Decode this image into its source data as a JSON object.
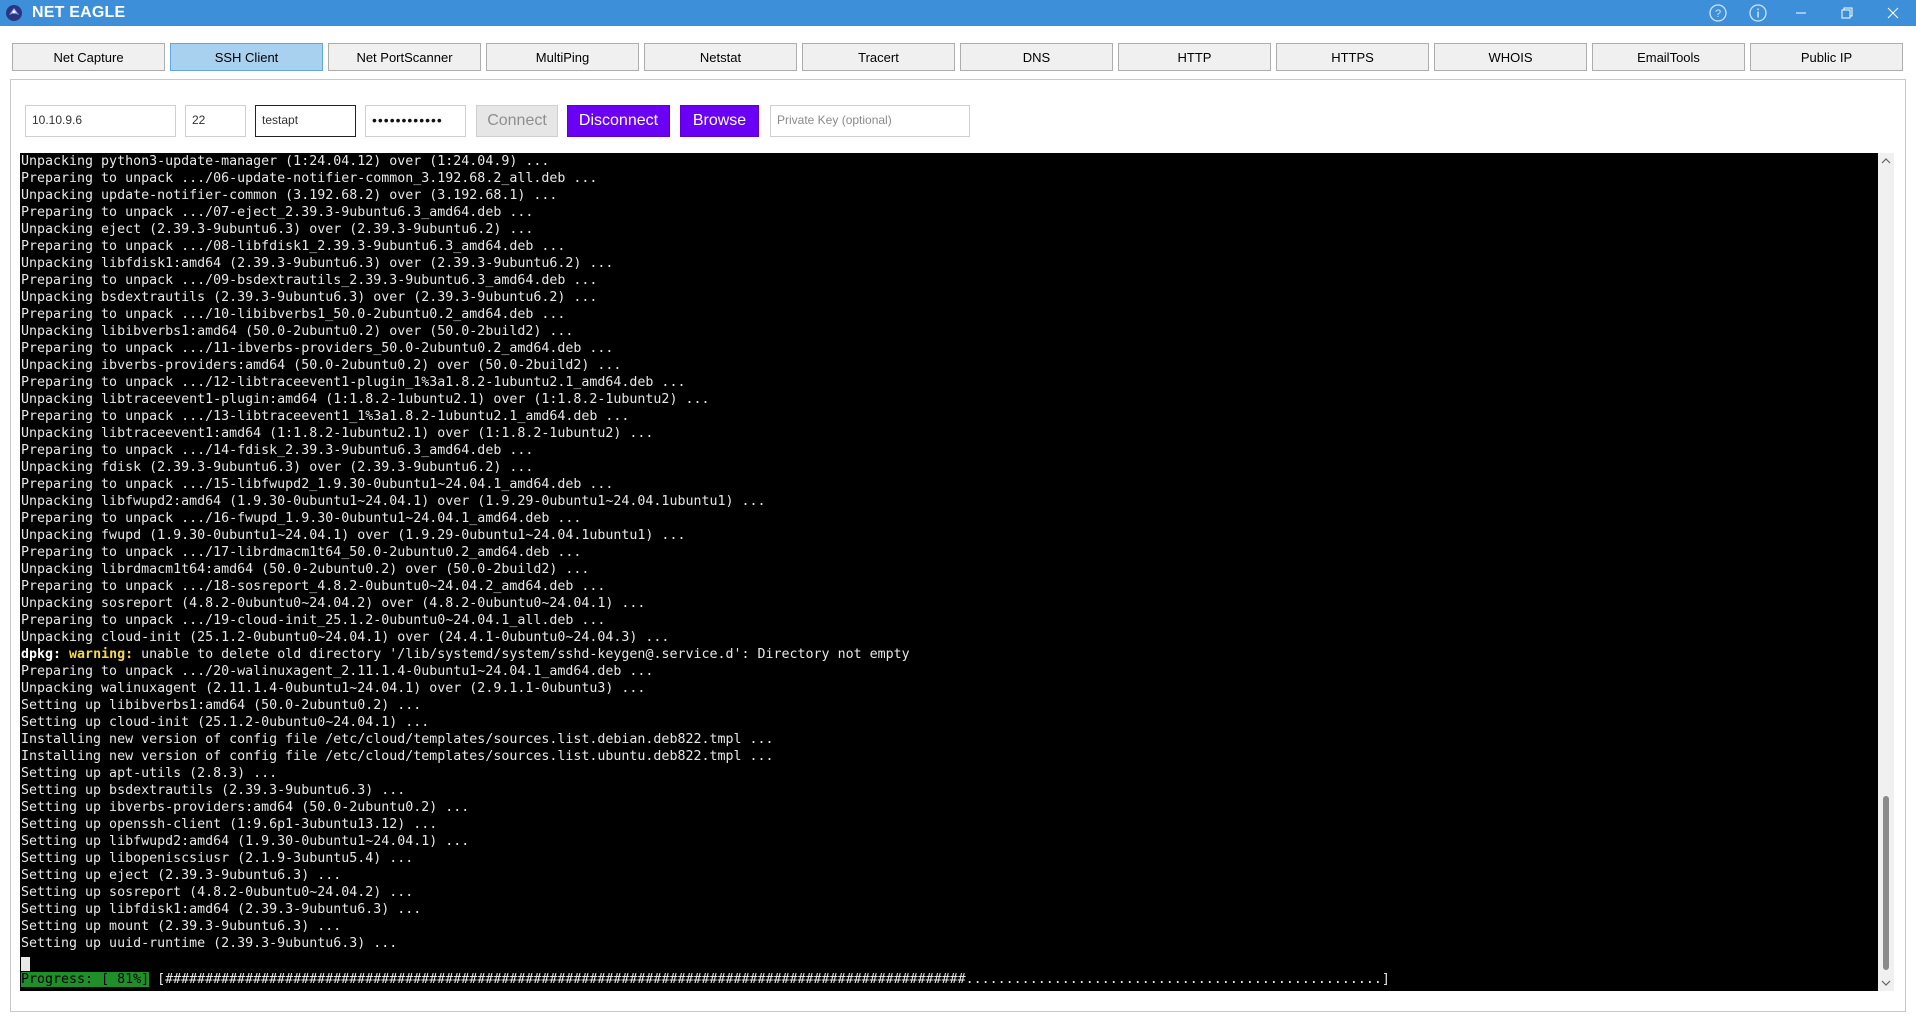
{
  "window": {
    "title": "NET EAGLE",
    "controls": [
      "help-icon",
      "info-icon",
      "minimize-icon",
      "restore-icon",
      "close-icon"
    ]
  },
  "tabs": [
    {
      "label": "Net Capture",
      "active": false
    },
    {
      "label": "SSH Client",
      "active": true
    },
    {
      "label": "Net PortScanner",
      "active": false
    },
    {
      "label": "MultiPing",
      "active": false
    },
    {
      "label": "Netstat",
      "active": false
    },
    {
      "label": "Tracert",
      "active": false
    },
    {
      "label": "DNS",
      "active": false
    },
    {
      "label": "HTTP",
      "active": false
    },
    {
      "label": "HTTPS",
      "active": false
    },
    {
      "label": "WHOIS",
      "active": false
    },
    {
      "label": "EmailTools",
      "active": false
    },
    {
      "label": "Public IP",
      "active": false
    }
  ],
  "ssh": {
    "host": "10.10.9.6",
    "port": "22",
    "username": "testapt",
    "password_mask": "••••••••••••",
    "connect_label": "Connect",
    "disconnect_label": "Disconnect",
    "browse_label": "Browse",
    "private_key_placeholder": "Private Key (optional)"
  },
  "terminal": {
    "lines": [
      "Unpacking python3-update-manager (1:24.04.12) over (1:24.04.9) ...",
      "Preparing to unpack .../06-update-notifier-common_3.192.68.2_all.deb ...",
      "Unpacking update-notifier-common (3.192.68.2) over (3.192.68.1) ...",
      "Preparing to unpack .../07-eject_2.39.3-9ubuntu6.3_amd64.deb ...",
      "Unpacking eject (2.39.3-9ubuntu6.3) over (2.39.3-9ubuntu6.2) ...",
      "Preparing to unpack .../08-libfdisk1_2.39.3-9ubuntu6.3_amd64.deb ...",
      "Unpacking libfdisk1:amd64 (2.39.3-9ubuntu6.3) over (2.39.3-9ubuntu6.2) ...",
      "Preparing to unpack .../09-bsdextrautils_2.39.3-9ubuntu6.3_amd64.deb ...",
      "Unpacking bsdextrautils (2.39.3-9ubuntu6.3) over (2.39.3-9ubuntu6.2) ...",
      "Preparing to unpack .../10-libibverbs1_50.0-2ubuntu0.2_amd64.deb ...",
      "Unpacking libibverbs1:amd64 (50.0-2ubuntu0.2) over (50.0-2build2) ...",
      "Preparing to unpack .../11-ibverbs-providers_50.0-2ubuntu0.2_amd64.deb ...",
      "Unpacking ibverbs-providers:amd64 (50.0-2ubuntu0.2) over (50.0-2build2) ...",
      "Preparing to unpack .../12-libtraceevent1-plugin_1%3a1.8.2-1ubuntu2.1_amd64.deb ...",
      "Unpacking libtraceevent1-plugin:amd64 (1:1.8.2-1ubuntu2.1) over (1:1.8.2-1ubuntu2) ...",
      "Preparing to unpack .../13-libtraceevent1_1%3a1.8.2-1ubuntu2.1_amd64.deb ...",
      "Unpacking libtraceevent1:amd64 (1:1.8.2-1ubuntu2.1) over (1:1.8.2-1ubuntu2) ...",
      "Preparing to unpack .../14-fdisk_2.39.3-9ubuntu6.3_amd64.deb ...",
      "Unpacking fdisk (2.39.3-9ubuntu6.3) over (2.39.3-9ubuntu6.2) ...",
      "Preparing to unpack .../15-libfwupd2_1.9.30-0ubuntu1~24.04.1_amd64.deb ...",
      "Unpacking libfwupd2:amd64 (1.9.30-0ubuntu1~24.04.1) over (1.9.29-0ubuntu1~24.04.1ubuntu1) ...",
      "Preparing to unpack .../16-fwupd_1.9.30-0ubuntu1~24.04.1_amd64.deb ...",
      "Unpacking fwupd (1.9.30-0ubuntu1~24.04.1) over (1.9.29-0ubuntu1~24.04.1ubuntu1) ...",
      "Preparing to unpack .../17-librdmacm1t64_50.0-2ubuntu0.2_amd64.deb ...",
      "Unpacking librdmacm1t64:amd64 (50.0-2ubuntu0.2) over (50.0-2build2) ...",
      "Preparing to unpack .../18-sosreport_4.8.2-0ubuntu0~24.04.2_amd64.deb ...",
      "Unpacking sosreport (4.8.2-0ubuntu0~24.04.2) over (4.8.2-0ubuntu0~24.04.1) ...",
      "Preparing to unpack .../19-cloud-init_25.1.2-0ubuntu0~24.04.1_all.deb ...",
      "Unpacking cloud-init (25.1.2-0ubuntu0~24.04.1) over (24.4.1-0ubuntu0~24.04.3) ...",
      "dpkg: warning: unable to delete old directory '/lib/systemd/system/sshd-keygen@.service.d': Directory not empty",
      "Preparing to unpack .../20-walinuxagent_2.11.1.4-0ubuntu1~24.04.1_amd64.deb ...",
      "Unpacking walinuxagent (2.11.1.4-0ubuntu1~24.04.1) over (2.9.1.1-0ubuntu3) ...",
      "Setting up libibverbs1:amd64 (50.0-2ubuntu0.2) ...",
      "Setting up cloud-init (25.1.2-0ubuntu0~24.04.1) ...",
      "Installing new version of config file /etc/cloud/templates/sources.list.debian.deb822.tmpl ...",
      "Installing new version of config file /etc/cloud/templates/sources.list.ubuntu.deb822.tmpl ...",
      "Setting up apt-utils (2.8.3) ...",
      "Setting up bsdextrautils (2.39.3-9ubuntu6.3) ...",
      "Setting up ibverbs-providers:amd64 (50.0-2ubuntu0.2) ...",
      "Setting up openssh-client (1:9.6p1-3ubuntu13.12) ...",
      "Setting up libfwupd2:amd64 (1.9.30-0ubuntu1~24.04.1) ...",
      "Setting up libopeniscsiusr (2.1.9-3ubuntu5.4) ...",
      "Setting up eject (2.39.3-9ubuntu6.3) ...",
      "Setting up sosreport (4.8.2-0ubuntu0~24.04.2) ...",
      "Setting up libfdisk1:amd64 (2.39.3-9ubuntu6.3) ...",
      "Setting up mount (2.39.3-9ubuntu6.3) ...",
      "Setting up uuid-runtime (2.39.3-9ubuntu6.3) ..."
    ],
    "warning_line_index": 29,
    "warning_prefix": "dpkg: ",
    "warning_word": "warning:",
    "progress_label": "Progress: [ 81%]",
    "progress_bar": " [####################################################################################################....................................................]",
    "progress_percent": 81,
    "colors": {
      "background": "#000000",
      "text": "#e8e8e8",
      "warning": "#f5d94a",
      "progress_label_bg": "#1f8f2a"
    }
  },
  "colors": {
    "titlebar": "#3d8fd9",
    "active_tab": "#a8d0ef",
    "primary_button": "#6a00f4"
  }
}
